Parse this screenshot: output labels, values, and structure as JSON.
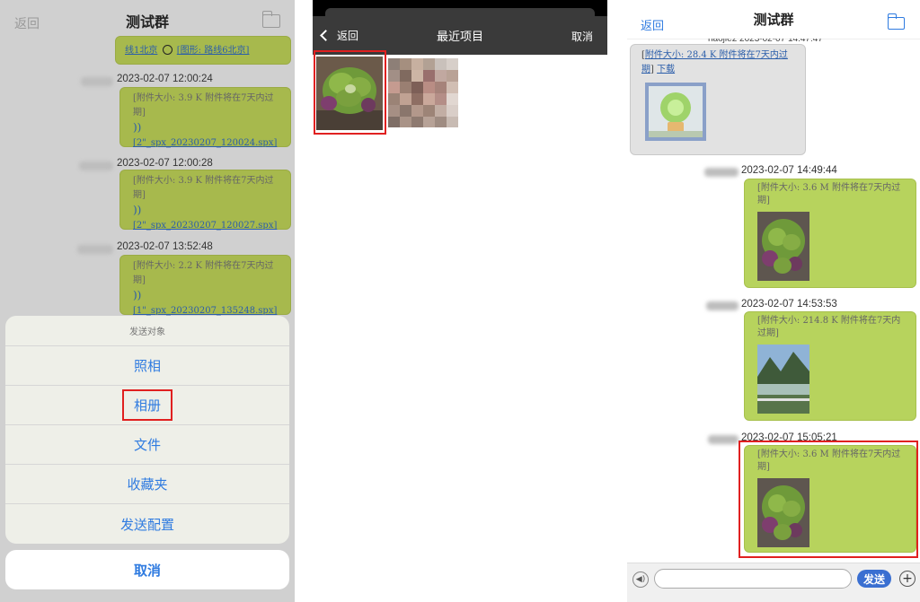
{
  "panel1": {
    "back_label": "返回",
    "title": "测试群",
    "top_bubble": {
      "link1": "线1北京",
      "link2": "[图形: 路线6北京]"
    },
    "messages": [
      {
        "timestamp": "2023-02-07 12:00:24",
        "info": "[附件大小: 3.9 K 附件将在7天内过期]",
        "file": "[2\"_spx_20230207_120024.spx]"
      },
      {
        "timestamp": "2023-02-07 12:00:28",
        "info": "[附件大小: 3.9 K 附件将在7天内过期]",
        "file": "[2\"_spx_20230207_120027.spx]"
      },
      {
        "timestamp": "2023-02-07 13:52:48",
        "info": "[附件大小: 2.2 K 附件将在7天内过期]",
        "file": "[1\"_spx_20230207_135248.spx]"
      }
    ],
    "sheet": {
      "title": "发送对象",
      "items": [
        "照相",
        "相册",
        "文件",
        "收藏夹",
        "发送配置"
      ],
      "cancel": "取消"
    }
  },
  "panel2": {
    "back_label": "返回",
    "title": "最近项目",
    "cancel_label": "取消"
  },
  "panel3": {
    "back_label": "返回",
    "title": "测试群",
    "first_sender": "haojie2 2023-02-07 14:47:47",
    "first_bubble": {
      "info": "附件大小: 28.4 K 附件将在7天内过期",
      "download": "下载"
    },
    "messages": [
      {
        "timestamp": "2023-02-07 14:49:44",
        "info": "[附件大小: 3.6 M 附件将在7天内过期]"
      },
      {
        "timestamp": "2023-02-07 14:53:53",
        "info": "[附件大小: 214.8 K 附件将在7天内过期]"
      },
      {
        "timestamp": "2023-02-07 15:05:21",
        "info": "[附件大小: 3.6 M 附件将在7天内过期]"
      }
    ],
    "send_label": "发送"
  }
}
